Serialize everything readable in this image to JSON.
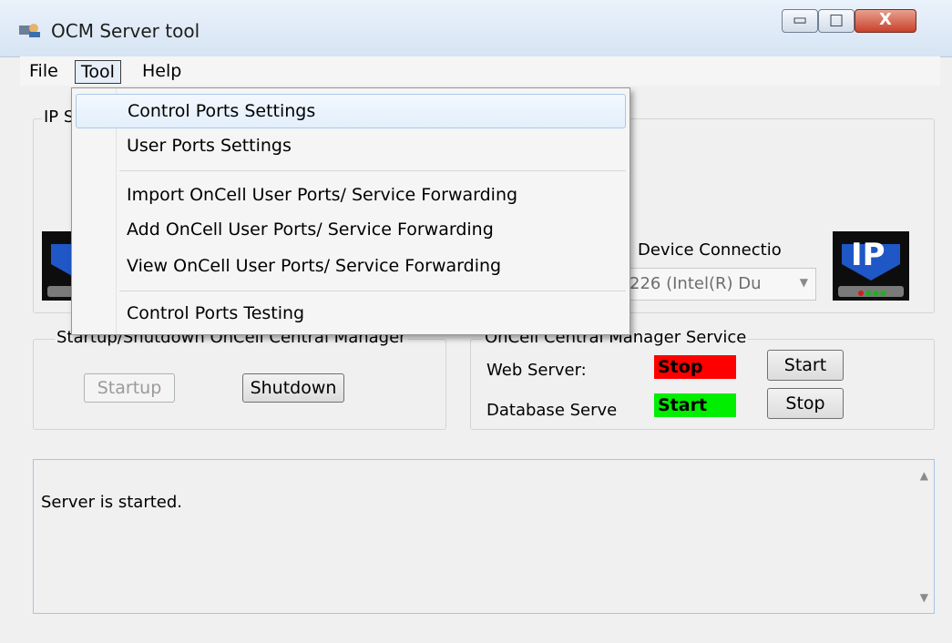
{
  "window": {
    "title": "OCM Server tool",
    "min_glyph": "▭",
    "max_glyph": "□",
    "close_glyph": "X"
  },
  "menubar": {
    "file": "File",
    "tool": "Tool",
    "help": "Help"
  },
  "tool_menu": {
    "items": [
      "Control Ports Settings",
      "User Ports Settings",
      "Import OnCell User Ports/ Service Forwarding",
      "Add OnCell User Ports/ Service Forwarding",
      "View OnCell User Ports/ Service Forwarding",
      "Control Ports Testing"
    ]
  },
  "ip_group": {
    "title_partial": "IP S",
    "device_connection_label": "Device Connectio",
    "device_combo_value": "226  (Intel(R) Du",
    "logo_text": "IP"
  },
  "startup_group": {
    "title": "Startup/Shutdown OnCell Central Manager",
    "startup_label": "Startup",
    "shutdown_label": "Shutdown"
  },
  "service_group": {
    "title": "OnCell Central Manager Service",
    "web_server_label": "Web Server:",
    "web_server_status": "Stop",
    "web_server_button": "Start",
    "db_server_label": "Database Serve",
    "db_server_status": "Start",
    "db_server_button": "Stop"
  },
  "log": {
    "text": "Server is started."
  },
  "colors": {
    "status_stop": "#ff0000",
    "status_start": "#00ee00",
    "highlight": "#e2effc"
  }
}
